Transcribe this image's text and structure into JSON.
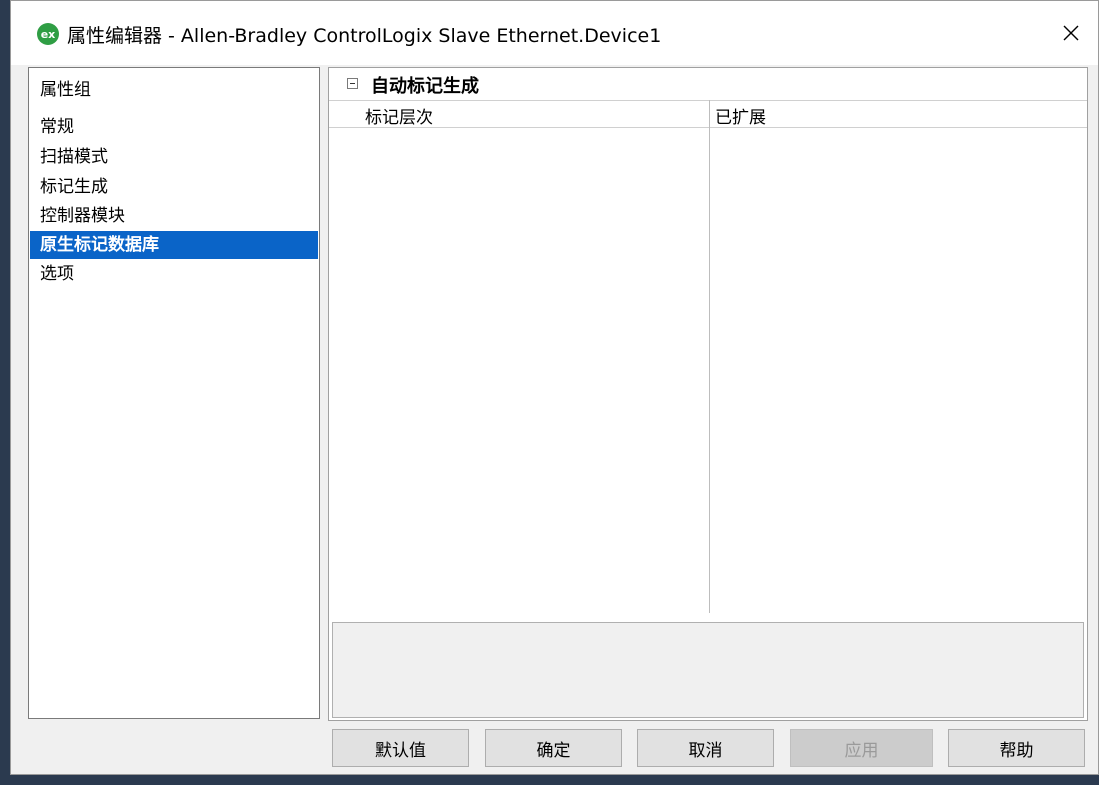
{
  "window": {
    "title": "属性编辑器 - Allen-Bradley ControlLogix Slave Ethernet.Device1",
    "app_icon_text": "ex"
  },
  "left_panel": {
    "items": [
      {
        "label": "属性组",
        "selected": false
      },
      {
        "label": "常规",
        "selected": false
      },
      {
        "label": "扫描模式",
        "selected": false
      },
      {
        "label": "标记生成",
        "selected": false
      },
      {
        "label": "控制器模块",
        "selected": false
      },
      {
        "label": "原生标记数据库",
        "selected": true
      },
      {
        "label": "选项",
        "selected": false
      }
    ]
  },
  "right_panel": {
    "section_title": "自动标记生成",
    "columns": [
      "标记层次",
      "已扩展"
    ]
  },
  "buttons": {
    "defaults": "默认值",
    "ok": "确定",
    "cancel": "取消",
    "apply": "应用",
    "help": "帮助"
  },
  "colors": {
    "selection": "#0a64c8",
    "app_icon": "#2f9e44"
  },
  "icons": {
    "app": "ex-app-icon",
    "close": "close-icon",
    "collapse": "minus-box-icon"
  }
}
